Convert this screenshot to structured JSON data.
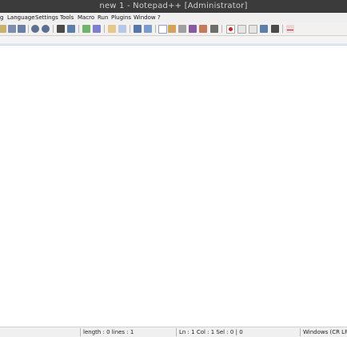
{
  "window": {
    "title": "new 1 - Notepad++ [Administrator]"
  },
  "menu": {
    "items": [
      "g",
      "Language",
      "Settings",
      "Tools",
      "Macro",
      "Run",
      "Plugins",
      "Window",
      "?"
    ]
  },
  "toolbar": {
    "icons": [
      "paste-icon",
      "copy-icon",
      "cut-icon",
      "undo-icon",
      "redo-icon",
      "find-icon",
      "replace-icon",
      "zoom-in-icon",
      "zoom-out-icon",
      "sync-v-icon",
      "sync-h-icon",
      "wrap-icon",
      "all-chars-icon",
      "indent-guide-icon",
      "udl-icon",
      "doc-map-icon",
      "func-list-icon",
      "folder-workspace-icon",
      "monitor-icon",
      "record-macro-icon",
      "stop-macro-icon",
      "play-macro-icon",
      "run-multiple-macro-icon",
      "save-macro-icon",
      "spellcheck-icon"
    ]
  },
  "status": {
    "length": "length : 0   lines : 1",
    "position": "Ln : 1    Col : 1    Sel : 0 | 0",
    "eol": "Windows (CR LF)"
  }
}
